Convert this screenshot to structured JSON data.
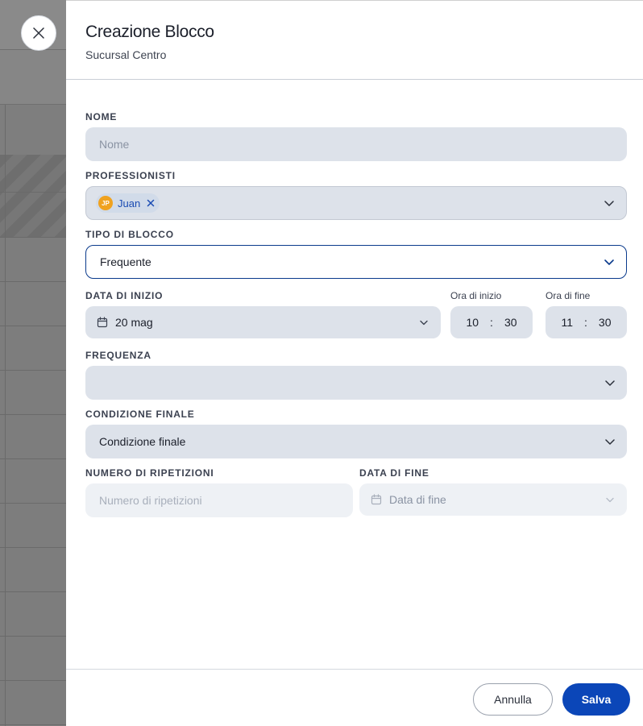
{
  "header": {
    "title": "Creazione Blocco",
    "subtitle": "Sucursal Centro"
  },
  "form": {
    "nome": {
      "label": "NOME",
      "placeholder": "Nome"
    },
    "professionisti": {
      "label": "PROFESSIONISTI",
      "chips": [
        {
          "initials": "JP",
          "name": "Juan"
        }
      ]
    },
    "tipo_blocco": {
      "label": "TIPO DI BLOCCO",
      "value": "Frequente"
    },
    "data_inizio": {
      "label": "DATA DI INIZIO",
      "value": "20 mag"
    },
    "ora_inizio": {
      "label": "Ora di inizio",
      "hour": "10",
      "minute": "30"
    },
    "ora_fine": {
      "label": "Ora di fine",
      "hour": "11",
      "minute": "30"
    },
    "frequenza": {
      "label": "FREQUENZA",
      "value": ""
    },
    "condizione_finale": {
      "label": "CONDIZIONE FINALE",
      "value": "Condizione finale"
    },
    "numero_ripetizioni": {
      "label": "NUMERO DI RIPETIZIONI",
      "placeholder": "Numero di ripetizioni"
    },
    "data_fine": {
      "label": "DATA DI FINE",
      "placeholder": "Data di fine"
    }
  },
  "footer": {
    "cancel_label": "Annulla",
    "save_label": "Salva"
  },
  "icons": {
    "close": "close-icon",
    "chevron": "chevron-down-icon",
    "calendar": "calendar-icon",
    "chip_remove": "x-icon"
  },
  "colors": {
    "primary": "#0b46b8",
    "field_bg": "#dde2ea",
    "avatar_bg": "#f0a21f",
    "chip_text": "#1a4bb3"
  }
}
